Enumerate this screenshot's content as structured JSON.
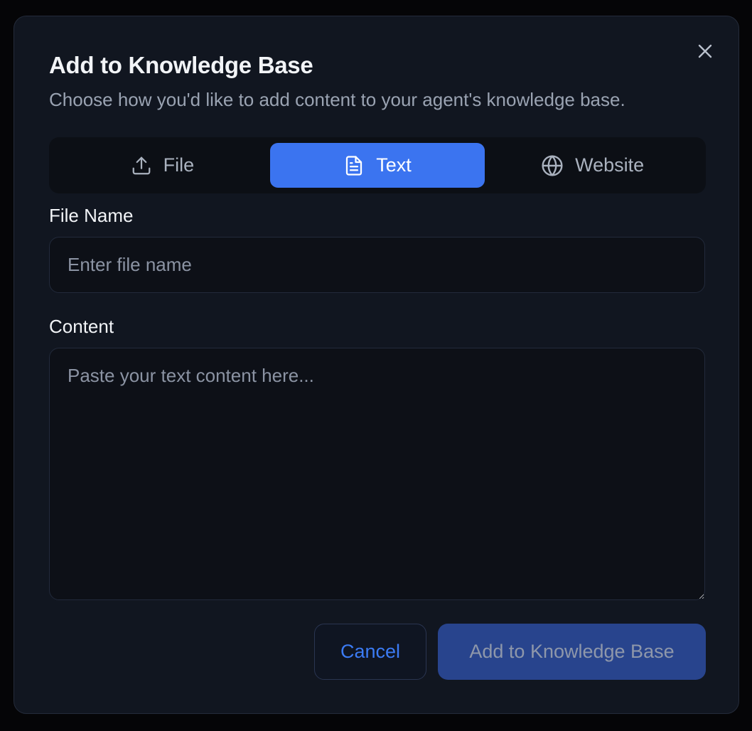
{
  "dialog": {
    "title": "Add to Knowledge Base",
    "subtitle": "Choose how you'd like to add content to your agent's knowledge base.",
    "close_icon": "close-icon"
  },
  "tabs": [
    {
      "label": "File",
      "icon": "upload-icon",
      "active": false
    },
    {
      "label": "Text",
      "icon": "document-icon",
      "active": true
    },
    {
      "label": "Website",
      "icon": "globe-icon",
      "active": false
    }
  ],
  "form": {
    "file_name_label": "File Name",
    "file_name_placeholder": "Enter file name",
    "file_name_value": "",
    "content_label": "Content",
    "content_placeholder": "Paste your text content here...",
    "content_value": ""
  },
  "actions": {
    "cancel_label": "Cancel",
    "submit_label": "Add to Knowledge Base"
  },
  "colors": {
    "accent": "#3b74f0",
    "dialog_bg": "#111620",
    "submit_disabled_bg": "#28448d"
  }
}
